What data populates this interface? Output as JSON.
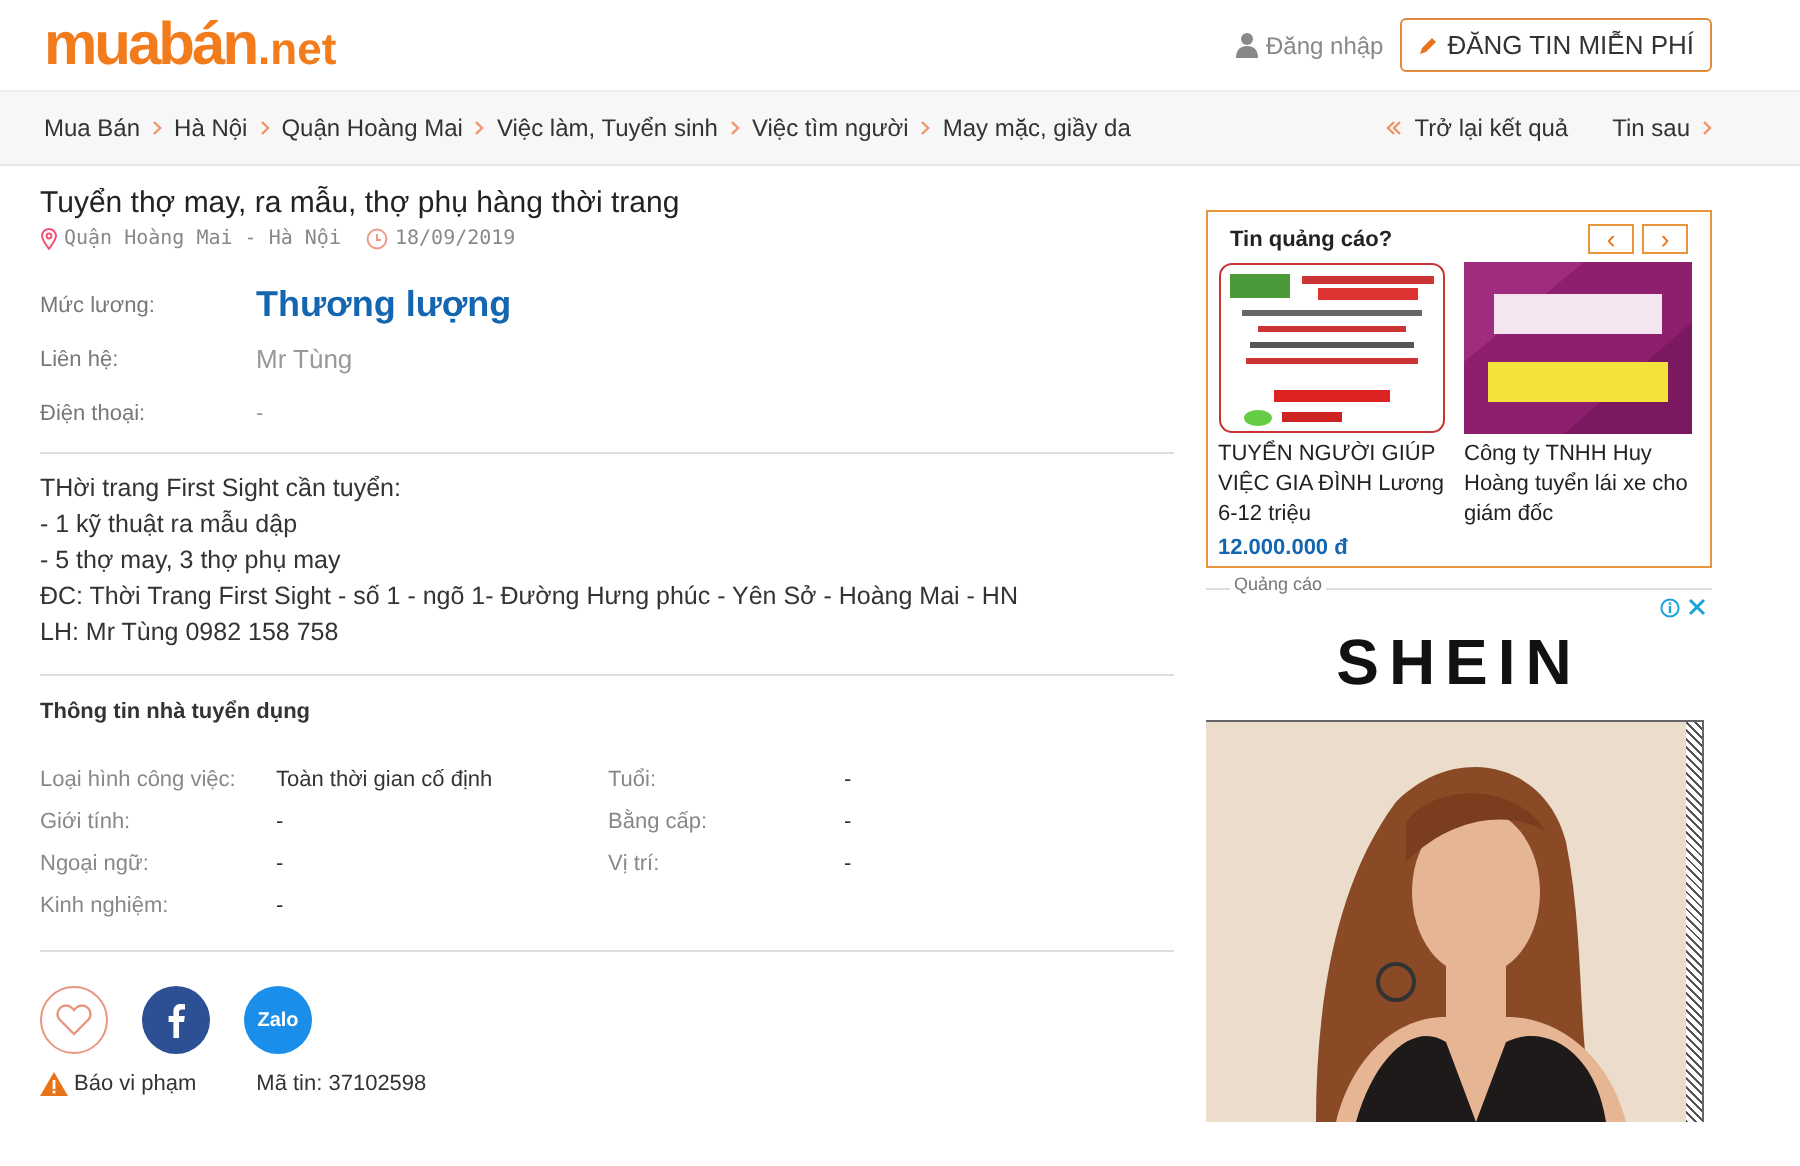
{
  "logo": {
    "brand": "muabán",
    "tld": ".net"
  },
  "header": {
    "login": "Đăng nhập",
    "post_button": "ĐĂNG TIN MIỄN PHÍ"
  },
  "breadcrumbs": [
    "Mua Bán",
    "Hà Nội",
    "Quận Hoàng Mai",
    "Việc làm, Tuyển sinh",
    "Việc tìm người",
    "May mặc, giầy da"
  ],
  "nav": {
    "back": "Trở lại kết quả",
    "next": "Tin sau"
  },
  "listing": {
    "title": "Tuyển thợ may, ra mẫu, thợ phụ hàng thời trang",
    "location": "Quận Hoàng Mai - Hà Nội",
    "date": "18/09/2019",
    "fields": [
      {
        "kind": "salary",
        "label": "Mức lương:",
        "value": "Thương lượng"
      },
      {
        "kind": "plain",
        "label": "Liên hệ:",
        "value": "Mr Tùng"
      },
      {
        "kind": "small",
        "label": "Điện thoại:",
        "value": "-"
      }
    ],
    "description": [
      "THời trang First Sight cần tuyển:",
      "- 1 kỹ thuật ra mẫu dập",
      "- 5 thợ may, 3 thợ phụ may",
      "ĐC: Thời Trang First Sight - số 1 - ngõ 1- Đường Hưng phúc - Yên Sở - Hoàng Mai - HN",
      "LH: Mr Tùng 0982 158 758"
    ],
    "employer_heading": "Thông tin nhà tuyển dụng",
    "employer_info": [
      {
        "label": "Loại hình công việc:",
        "value": "Toàn thời gian cố định"
      },
      {
        "label": "Tuổi:",
        "value": "-"
      },
      {
        "label": "Giới tính:",
        "value": "-"
      },
      {
        "label": "Bằng cấp:",
        "value": "-"
      },
      {
        "label": "Ngoại ngữ:",
        "value": "-"
      },
      {
        "label": "Vị trí:",
        "value": "-"
      },
      {
        "label": "Kinh nghiệm:",
        "value": "-"
      }
    ],
    "share": [
      {
        "kind": "favorite"
      },
      {
        "kind": "facebook"
      },
      {
        "kind": "zalo",
        "label": "Zalo"
      }
    ],
    "report": "Báo vi phạm",
    "listing_id": "Mã tin: 37102598"
  },
  "ads": {
    "title": "Tin quảng cáo?",
    "prev": "‹",
    "next": "›",
    "items": [
      {
        "kind": "picture",
        "text": "TUYỂN NGƯỜI GIÚP VIỆC GIA ĐÌNH Lương 6-12 triệu",
        "price": "12.000.000 đ"
      },
      {
        "kind": "picture",
        "text": "Công ty TNHH Huy Hoàng tuyển lái xe cho giám đốc"
      }
    ]
  },
  "banner": {
    "label": "Quảng cáo",
    "brand": "SHEIN"
  }
}
